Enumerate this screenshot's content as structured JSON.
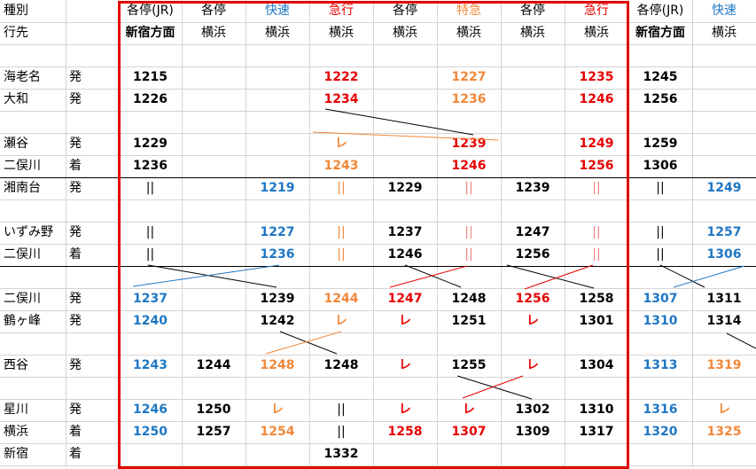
{
  "colors": {
    "black": "#000000",
    "blue": "#1f77c4",
    "red": "#e60000",
    "orange": "#f0883a",
    "pink": "#f08080"
  },
  "headers": {
    "row1_label": "種別",
    "row2_label": "行先",
    "types": [
      "各停(JR)",
      "各停",
      "快速",
      "急行",
      "各停",
      "特急",
      "各停",
      "急行",
      "各停(JR)",
      "快速"
    ],
    "type_colors": [
      "black",
      "black",
      "blue",
      "red",
      "black",
      "orange",
      "black",
      "red",
      "black",
      "blue"
    ],
    "dests": [
      "新宿方面",
      "横浜",
      "横浜",
      "横浜",
      "横浜",
      "横浜",
      "横浜",
      "横浜",
      "新宿方面",
      "横浜"
    ],
    "dest_bold": [
      true,
      false,
      false,
      false,
      false,
      false,
      false,
      false,
      true,
      false
    ]
  },
  "rows": [
    {
      "station": "",
      "kind": "",
      "cells": [
        null,
        null,
        null,
        null,
        null,
        null,
        null,
        null,
        null,
        null
      ]
    },
    {
      "station": "海老名",
      "kind": "発",
      "cells": [
        [
          "1215",
          "black"
        ],
        null,
        null,
        [
          "1222",
          "red"
        ],
        null,
        [
          "1227",
          "orange"
        ],
        null,
        [
          "1235",
          "red"
        ],
        [
          "1245",
          "black"
        ],
        null
      ]
    },
    {
      "station": "大和",
      "kind": "発",
      "cells": [
        [
          "1226",
          "black"
        ],
        null,
        null,
        [
          "1234",
          "red"
        ],
        null,
        [
          "1236",
          "orange"
        ],
        null,
        [
          "1246",
          "red"
        ],
        [
          "1256",
          "black"
        ],
        null
      ]
    },
    {
      "station": "",
      "kind": "",
      "cells": [
        null,
        null,
        null,
        null,
        null,
        null,
        null,
        null,
        null,
        null
      ]
    },
    {
      "station": "瀬谷",
      "kind": "発",
      "cells": [
        [
          "1229",
          "black"
        ],
        null,
        null,
        [
          "レ",
          "orange"
        ],
        null,
        [
          "1239",
          "red"
        ],
        null,
        [
          "1249",
          "red"
        ],
        [
          "1259",
          "black"
        ],
        null
      ]
    },
    {
      "station": "二俣川",
      "kind": "着",
      "cells": [
        [
          "1236",
          "black"
        ],
        null,
        null,
        [
          "1243",
          "orange"
        ],
        null,
        [
          "1246",
          "red"
        ],
        null,
        [
          "1256",
          "red"
        ],
        [
          "1306",
          "black"
        ],
        null
      ]
    },
    {
      "station": "湘南台",
      "kind": "発",
      "cells": [
        [
          "||",
          "black"
        ],
        null,
        [
          "1219",
          "blue"
        ],
        [
          "||",
          "orange"
        ],
        [
          "1229",
          "black"
        ],
        [
          "||",
          "red"
        ],
        [
          "1239",
          "black"
        ],
        [
          "||",
          "red"
        ],
        [
          "||",
          "black"
        ],
        [
          "1249",
          "blue"
        ]
      ]
    },
    {
      "station": "",
      "kind": "",
      "cells": [
        null,
        null,
        null,
        null,
        null,
        null,
        null,
        null,
        null,
        null
      ]
    },
    {
      "station": "いずみ野",
      "kind": "発",
      "cells": [
        [
          "||",
          "black"
        ],
        null,
        [
          "1227",
          "blue"
        ],
        [
          "||",
          "orange"
        ],
        [
          "1237",
          "black"
        ],
        [
          "||",
          "red"
        ],
        [
          "1247",
          "black"
        ],
        [
          "||",
          "red"
        ],
        [
          "||",
          "black"
        ],
        [
          "1257",
          "blue"
        ]
      ]
    },
    {
      "station": "二俣川",
      "kind": "着",
      "cells": [
        [
          "||",
          "black"
        ],
        null,
        [
          "1236",
          "blue"
        ],
        [
          "||",
          "orange"
        ],
        [
          "1246",
          "black"
        ],
        [
          "||",
          "red"
        ],
        [
          "1256",
          "black"
        ],
        [
          "||",
          "red"
        ],
        [
          "||",
          "black"
        ],
        [
          "1306",
          "blue"
        ]
      ]
    },
    {
      "station": "",
      "kind": "",
      "cells": [
        null,
        null,
        null,
        null,
        null,
        null,
        null,
        null,
        null,
        null
      ]
    },
    {
      "station": "二俣川",
      "kind": "発",
      "cells": [
        [
          "1237",
          "blue"
        ],
        null,
        [
          "1239",
          "black"
        ],
        [
          "1244",
          "orange"
        ],
        [
          "1247",
          "red"
        ],
        [
          "1248",
          "black"
        ],
        [
          "1256",
          "red"
        ],
        [
          "1258",
          "black"
        ],
        [
          "1307",
          "blue"
        ],
        [
          "1311",
          "black"
        ]
      ]
    },
    {
      "station": "鶴ヶ峰",
      "kind": "発",
      "cells": [
        [
          "1240",
          "blue"
        ],
        null,
        [
          "1242",
          "black"
        ],
        [
          "レ",
          "orange"
        ],
        [
          "レ",
          "red"
        ],
        [
          "1251",
          "black"
        ],
        [
          "レ",
          "red"
        ],
        [
          "1301",
          "black"
        ],
        [
          "1310",
          "blue"
        ],
        [
          "1314",
          "black"
        ]
      ]
    },
    {
      "station": "",
      "kind": "",
      "cells": [
        null,
        null,
        null,
        null,
        null,
        null,
        null,
        null,
        null,
        null
      ]
    },
    {
      "station": "西谷",
      "kind": "発",
      "cells": [
        [
          "1243",
          "blue"
        ],
        [
          "1244",
          "black"
        ],
        [
          "1248",
          "orange"
        ],
        [
          "1248",
          "black"
        ],
        [
          "レ",
          "red"
        ],
        [
          "1255",
          "black"
        ],
        [
          "レ",
          "red"
        ],
        [
          "1304",
          "black"
        ],
        [
          "1313",
          "blue"
        ],
        [
          "1319",
          "orange"
        ]
      ]
    },
    {
      "station": "",
      "kind": "",
      "cells": [
        null,
        null,
        null,
        null,
        null,
        null,
        null,
        null,
        null,
        null
      ]
    },
    {
      "station": "星川",
      "kind": "発",
      "cells": [
        [
          "1246",
          "blue"
        ],
        [
          "1250",
          "black"
        ],
        [
          "レ",
          "orange"
        ],
        [
          "||",
          "black"
        ],
        [
          "レ",
          "red"
        ],
        [
          "レ",
          "red"
        ],
        [
          "1302",
          "black"
        ],
        [
          "1310",
          "black"
        ],
        [
          "1316",
          "blue"
        ],
        [
          "レ",
          "orange"
        ]
      ]
    },
    {
      "station": "横浜",
      "kind": "着",
      "cells": [
        [
          "1250",
          "blue"
        ],
        [
          "1257",
          "black"
        ],
        [
          "1254",
          "orange"
        ],
        [
          "||",
          "black"
        ],
        [
          "1258",
          "red"
        ],
        [
          "1307",
          "red"
        ],
        [
          "1309",
          "black"
        ],
        [
          "1317",
          "black"
        ],
        [
          "1320",
          "blue"
        ],
        [
          "1325",
          "orange"
        ]
      ]
    },
    {
      "station": "新宿",
      "kind": "着",
      "cells": [
        null,
        null,
        null,
        [
          "1332",
          "black"
        ],
        null,
        null,
        null,
        null,
        null,
        null
      ]
    }
  ]
}
